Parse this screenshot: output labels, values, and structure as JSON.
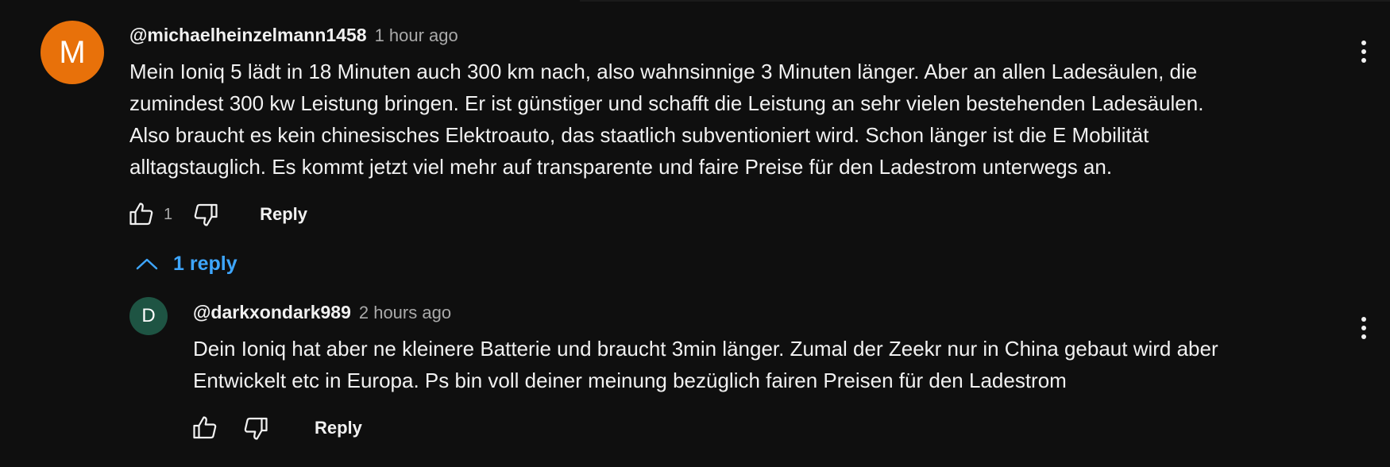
{
  "comments": [
    {
      "avatar_letter": "M",
      "author": "@michaelheinzelmann1458",
      "time": "1 hour ago",
      "lines": [
        "Mein Ioniq 5 lädt in 18 Minuten  auch 300 km nach, also wahnsinnige 3 Minuten länger. Aber an allen Ladesäulen, die",
        "zumindest 300 kw Leistung bringen. Er ist günstiger und schafft die Leistung an sehr vielen bestehenden Ladesäulen.",
        "Also braucht es kein chinesisches Elektroauto, das staatlich subventioniert wird. Schon länger ist die E Mobilität",
        "alltagstauglich. Es kommt jetzt viel mehr auf transparente und faire Preise für den Ladestrom unterwegs an."
      ],
      "like_count": "1",
      "reply_label": "Reply",
      "avatar_color": "#e8710a"
    },
    {
      "avatar_letter": "D",
      "author": "@darkxondark989",
      "time": "2 hours ago",
      "lines": [
        "Dein Ioniq hat aber ne kleinere Batterie und braucht 3min länger. Zumal der Zeekr nur in China gebaut wird aber",
        "Entwickelt etc in Europa.  Ps bin voll deiner meinung bezüglich fairen Preisen für den Ladestrom"
      ],
      "like_count": "",
      "reply_label": "Reply",
      "avatar_color": "#1e5443"
    }
  ],
  "replies_toggle": {
    "label": "1 reply",
    "icon": "chevron-up-icon",
    "color": "#3ea6ff"
  },
  "icons": {
    "like": "thumbs-up-icon",
    "dislike": "thumbs-down-icon",
    "more": "more-vertical-icon"
  },
  "theme": {
    "background": "#0f0f0f",
    "text": "#f1f1f1",
    "secondary_text": "#aaaaaa"
  }
}
